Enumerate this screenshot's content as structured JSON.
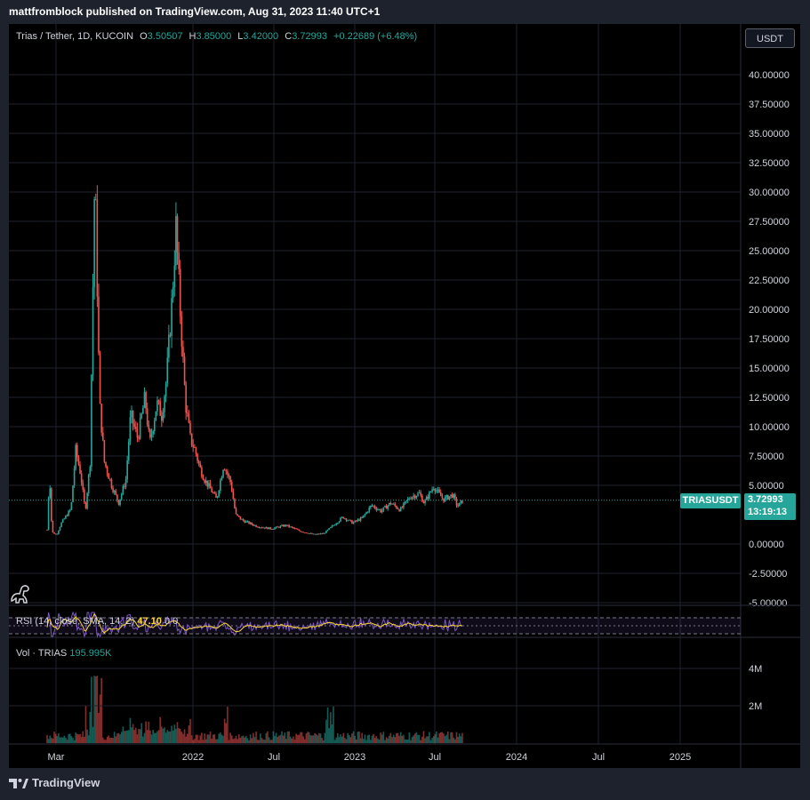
{
  "header": {
    "published": "mattfromblock published on TradingView.com, Aug 31, 2023 11:40 UTC+1"
  },
  "symbol": {
    "name": "Trias / Tether, 1D, KUCOIN",
    "o_label": "O",
    "o_value": "3.50507",
    "h_label": "H",
    "h_value": "3.85000",
    "l_label": "L",
    "l_value": "3.42000",
    "c_label": "C",
    "c_value": "3.72993",
    "change": "+0.22689 (+6.48%)"
  },
  "currency_button": "USDT",
  "last_price": {
    "ticker": "TRIASUSDT",
    "price": "3.72993",
    "countdown": "13:19:13"
  },
  "rsi": {
    "label": "RSI (14, close, SMA, 14, 2)",
    "value": "47.10",
    "value2": "0",
    "value3": "0"
  },
  "volume": {
    "label": "Vol · TRIAS",
    "value": "195.995K",
    "axis_labels": [
      "4M",
      "2M"
    ]
  },
  "footer": {
    "brand": "TradingView"
  },
  "colors": {
    "up": "#26a69a",
    "down": "#ef5350",
    "rsi_line": "#7e57c2",
    "rsi_ma": "#fdd835",
    "background": "#000000"
  },
  "chart_data": {
    "type": "candlestick",
    "symbol": "TRIASUSDT",
    "interval": "1D",
    "y_axis_labels": [
      "40.00000",
      "37.50000",
      "35.00000",
      "32.50000",
      "30.00000",
      "27.50000",
      "25.00000",
      "22.50000",
      "20.00000",
      "17.50000",
      "15.00000",
      "12.50000",
      "10.00000",
      "7.50000",
      "5.00000",
      "0.00000",
      "-2.50000",
      "-5.00000"
    ],
    "x_axis_labels": [
      "Mar",
      "2022",
      "Jul",
      "2023",
      "Jul",
      "2024",
      "Jul",
      "2025"
    ],
    "ylim": [
      -5,
      40
    ],
    "last_price": 3.72993,
    "series": [
      {
        "name": "price",
        "points": [
          [
            0,
            1.2
          ],
          [
            5,
            6.0
          ],
          [
            10,
            1.0
          ],
          [
            20,
            0.8
          ],
          [
            30,
            1.8
          ],
          [
            50,
            3.0
          ],
          [
            60,
            8.0
          ],
          [
            70,
            6.0
          ],
          [
            80,
            2.8
          ],
          [
            90,
            7.0
          ],
          [
            100,
            32.0
          ],
          [
            110,
            12.0
          ],
          [
            120,
            7.0
          ],
          [
            135,
            5.0
          ],
          [
            150,
            3.5
          ],
          [
            165,
            5.5
          ],
          [
            175,
            11.0
          ],
          [
            190,
            9.0
          ],
          [
            205,
            12.5
          ],
          [
            215,
            8.5
          ],
          [
            230,
            12.0
          ],
          [
            240,
            11.0
          ],
          [
            250,
            14.0
          ],
          [
            262,
            21.0
          ],
          [
            270,
            27.0
          ],
          [
            280,
            19.0
          ],
          [
            290,
            12.0
          ],
          [
            300,
            9.0
          ],
          [
            310,
            8.0
          ],
          [
            320,
            6.5
          ],
          [
            330,
            5.5
          ],
          [
            345,
            4.5
          ],
          [
            355,
            3.8
          ],
          [
            370,
            6.8
          ],
          [
            385,
            5.2
          ],
          [
            395,
            2.5
          ],
          [
            410,
            2.0
          ],
          [
            440,
            1.5
          ],
          [
            470,
            1.3
          ],
          [
            500,
            1.6
          ],
          [
            530,
            1.1
          ],
          [
            560,
            0.8
          ],
          [
            580,
            0.9
          ],
          [
            600,
            1.6
          ],
          [
            620,
            2.3
          ],
          [
            640,
            1.8
          ],
          [
            660,
            2.2
          ],
          [
            680,
            3.3
          ],
          [
            700,
            2.8
          ],
          [
            720,
            3.5
          ],
          [
            740,
            2.9
          ],
          [
            760,
            4.0
          ],
          [
            780,
            4.3
          ],
          [
            790,
            3.5
          ],
          [
            800,
            4.2
          ],
          [
            810,
            4.9
          ],
          [
            830,
            3.8
          ],
          [
            850,
            4.2
          ],
          [
            860,
            3.2
          ],
          [
            872,
            3.73
          ]
        ]
      }
    ]
  }
}
